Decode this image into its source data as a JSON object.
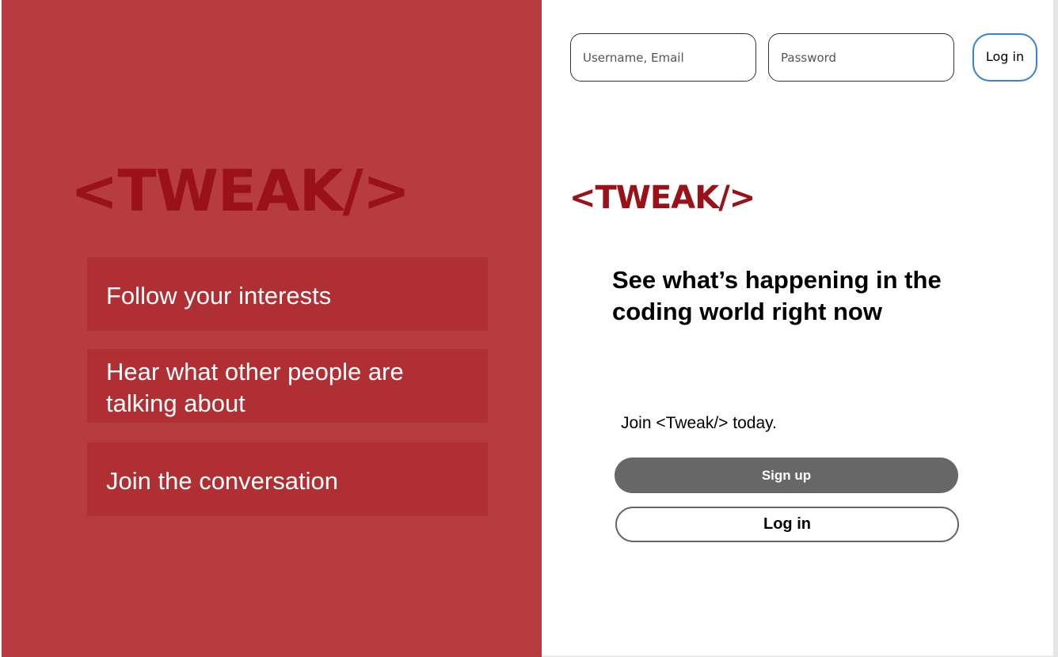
{
  "brand": {
    "logo_text": "<TWEAK/>",
    "color": "#9a1218"
  },
  "left_panel": {
    "background": "#b63c3f",
    "features": [
      "Follow your interests",
      "Hear what other people are talking about",
      "Join the conversation"
    ]
  },
  "login_bar": {
    "username_placeholder": "Username, Email",
    "password_placeholder": "Password",
    "login_label": "Log in"
  },
  "main": {
    "headline": "See what’s happening in the coding world right now",
    "join_text": "Join <Tweak/> today.",
    "signup_label": "Sign up",
    "login_label": "Log in"
  }
}
